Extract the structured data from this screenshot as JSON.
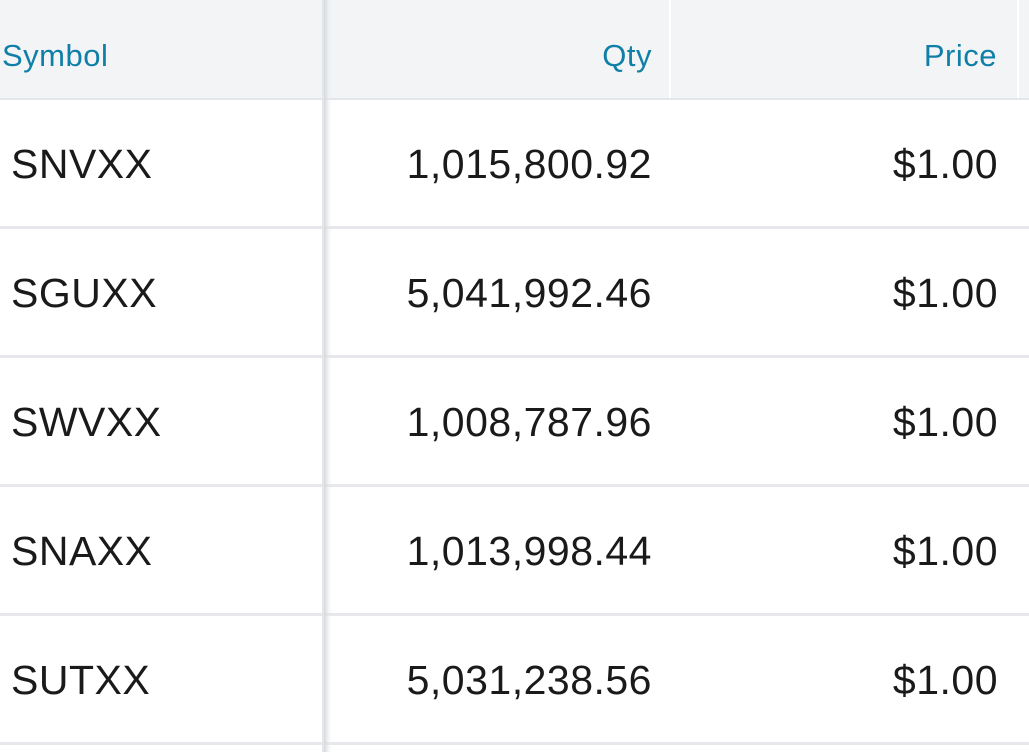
{
  "holdings_table": {
    "columns": {
      "symbol": "Symbol",
      "qty": "Qty",
      "price": "Price"
    },
    "rows": [
      {
        "symbol": "SNVXX",
        "qty": "1,015,800.92",
        "price": "$1.00"
      },
      {
        "symbol": "SGUXX",
        "qty": "5,041,992.46",
        "price": "$1.00"
      },
      {
        "symbol": "SWVXX",
        "qty": "1,008,787.96",
        "price": "$1.00"
      },
      {
        "symbol": "SNAXX",
        "qty": "1,013,998.44",
        "price": "$1.00"
      },
      {
        "symbol": "SUTXX",
        "qty": "5,031,238.56",
        "price": "$1.00"
      }
    ]
  },
  "colors": {
    "header_text": "#0f7fa8",
    "header_bg": "#f2f4f6",
    "cell_text": "#1a1a1a",
    "row_divider": "#e6e8eb"
  }
}
